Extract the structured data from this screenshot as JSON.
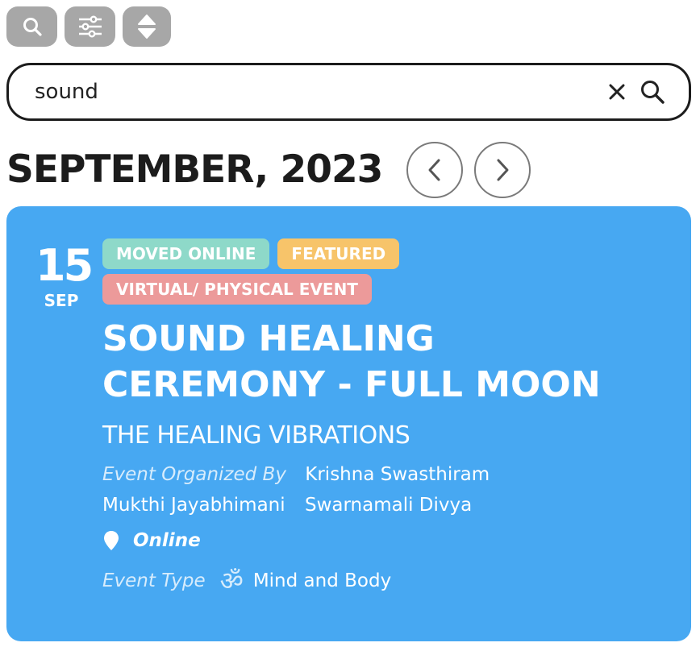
{
  "toolbar": {
    "buttons": [
      {
        "icon": "search-icon"
      },
      {
        "icon": "sliders-icon"
      },
      {
        "icon": "sort-icon"
      }
    ]
  },
  "search": {
    "value": "sound",
    "clear_icon": "close-icon",
    "submit_icon": "search-icon"
  },
  "calendar": {
    "month_title": "SEPTEMBER, 2023",
    "prev_icon": "chevron-left-icon",
    "next_icon": "chevron-right-icon"
  },
  "event": {
    "day": "15",
    "month": "SEP",
    "badges": [
      "MOVED ONLINE",
      "FEATURED",
      "VIRTUAL/ PHYSICAL EVENT"
    ],
    "title": "SOUND HEALING CEREMONY - FULL MOON",
    "subtitle": "THE HEALING VIBRATIONS",
    "organized_label": "Event Organized By",
    "organizers": [
      "Krishna Swasthiram",
      "Mukthi Jayabhimani",
      "Swarnamali Divya"
    ],
    "location": "Online",
    "type_label": "Event Type",
    "type_icon_glyph": "ॐ",
    "type_value": "Mind and Body"
  },
  "colors": {
    "card_bg": "#47a8f2",
    "badge_online": "#8ed9c9",
    "badge_featured": "#f7c46a",
    "badge_virtual": "#ec9a9a",
    "toolbar_btn": "#a7a7a7"
  }
}
